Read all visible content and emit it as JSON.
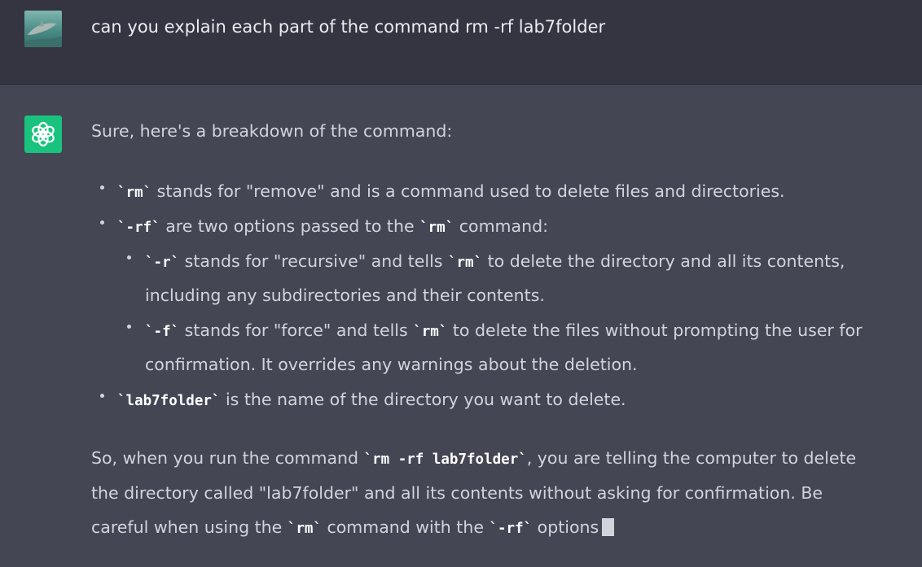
{
  "user_message": {
    "text": "can you explain each part of the command rm -rf lab7folder"
  },
  "assistant_message": {
    "intro": "Sure, here's a breakdown of the command:",
    "bullets": [
      {
        "code": "`rm`",
        "text": " stands for \"remove\" and is a command used to delete files and directories."
      },
      {
        "code": "`-rf`",
        "text_a": " are two options passed to the ",
        "code_b": "`rm`",
        "text_b": " command:",
        "sub": [
          {
            "code": "`-r`",
            "text_a": " stands for \"recursive\" and tells ",
            "code_b": "`rm`",
            "text_b": " to delete the directory and all its contents,",
            "cont": "including any subdirectories and their contents."
          },
          {
            "code": "`-f`",
            "text_a": " stands for \"force\" and tells ",
            "code_b": "`rm`",
            "text_b": " to delete the files without prompting the user for",
            "cont": "confirmation. It overrides any warnings about the deletion."
          }
        ]
      },
      {
        "code": "`lab7folder`",
        "text": " is the name of the directory you want to delete."
      }
    ],
    "summary": {
      "l1_a": "So, when you run the command ",
      "l1_code": "`rm -rf lab7folder`",
      "l1_b": ", you are telling the computer to delete",
      "l2": "the directory called \"lab7folder\" and all its contents without asking for confirmation. Be",
      "l3_a": "careful when using the ",
      "l3_code": "`rm`",
      "l3_b": " command with the ",
      "l3_code2": "`-rf`",
      "l3_c": " options"
    }
  },
  "colors": {
    "user_bg": "#343541",
    "assistant_bg": "#444654",
    "logo_bg": "#19c37d",
    "text": "#d1d5db"
  },
  "icons": {
    "user_avatar": "dolphin-photo-avatar",
    "assistant_avatar": "openai-logo-icon"
  }
}
